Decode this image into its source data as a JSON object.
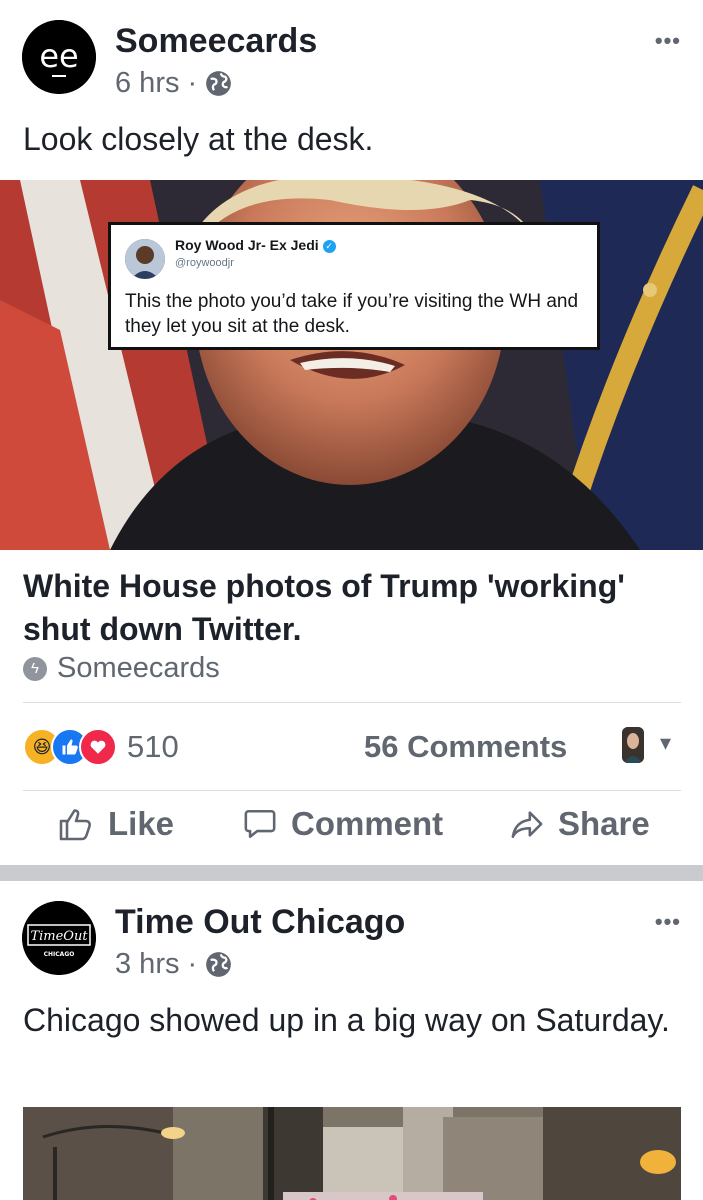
{
  "posts": [
    {
      "page_name": "Someecards",
      "time": "6 hrs",
      "dot": "·",
      "caption": "Look closely at the desk.",
      "more": "•••",
      "tweet": {
        "name": "Roy Wood Jr- Ex Jedi",
        "handle": "@roywoodjr",
        "text": "This the photo you’d take if you’re visiting the WH and they let you sit at the desk."
      },
      "headline": "White House photos of Trump 'working' shut down Twitter.",
      "source": "Someecards",
      "reaction_count": "510",
      "comments": "56 Comments",
      "actions": {
        "like": "Like",
        "comment": "Comment",
        "share": "Share"
      }
    },
    {
      "page_name": "Time Out Chicago",
      "time": "3 hrs",
      "dot": "·",
      "caption": "Chicago showed up in a big way on Saturday.",
      "more": "•••",
      "logo_text": "TimeOut",
      "logo_sub": "CHICAGO"
    }
  ],
  "icons": {
    "logo_someecards": "ee-logo",
    "globe": "globe-icon",
    "verified": "verified-badge-icon",
    "source": "lightning-icon",
    "reactions": [
      "haha-reaction-icon",
      "like-reaction-icon",
      "love-reaction-icon"
    ],
    "like": "thumbs-up-icon",
    "comment": "speech-bubble-icon",
    "share": "share-arrow-icon",
    "caret": "caret-down-icon"
  },
  "colors": {
    "text": "#1d2129",
    "secondary": "#606770",
    "separator": "#cacbcf",
    "like_blue": "#1877f2",
    "love_red": "#f0284a",
    "haha_yellow": "#f7b125",
    "twitter_blue": "#1da1f2"
  }
}
